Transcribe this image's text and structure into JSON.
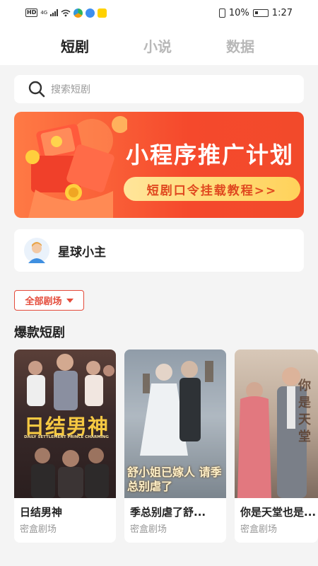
{
  "status_bar": {
    "left_labels": [
      "HD",
      "4G"
    ],
    "battery": "10%",
    "time": "1:27"
  },
  "tabs": [
    {
      "label": "短剧",
      "active": true
    },
    {
      "label": "小说",
      "active": false
    },
    {
      "label": "数据",
      "active": false
    }
  ],
  "search": {
    "placeholder": "搜索短剧",
    "icon": "search-icon"
  },
  "banner": {
    "title": "小程序推广计划",
    "subtitle": "短剧口令挂载教程>>",
    "brand_color": "#f5492c"
  },
  "planet": {
    "name": "星球小主",
    "icon": "avatar"
  },
  "filter": {
    "label": "全部剧场",
    "accent": "#e44b3a"
  },
  "section": {
    "title": "爆款短剧"
  },
  "dramas": [
    {
      "title": "日结男神",
      "source": "密盒剧场",
      "poster_title": "日结男神",
      "poster_subtitle": "DAILY SETTLEMENT PRINCE CHARMING"
    },
    {
      "title": "季总别虐了舒...",
      "source": "密盒剧场",
      "poster_title": "舒小姐已嫁人 请季总别虐了"
    },
    {
      "title": "你是天堂也是...",
      "source": "密盒剧场",
      "poster_title": "你是天堂"
    }
  ]
}
